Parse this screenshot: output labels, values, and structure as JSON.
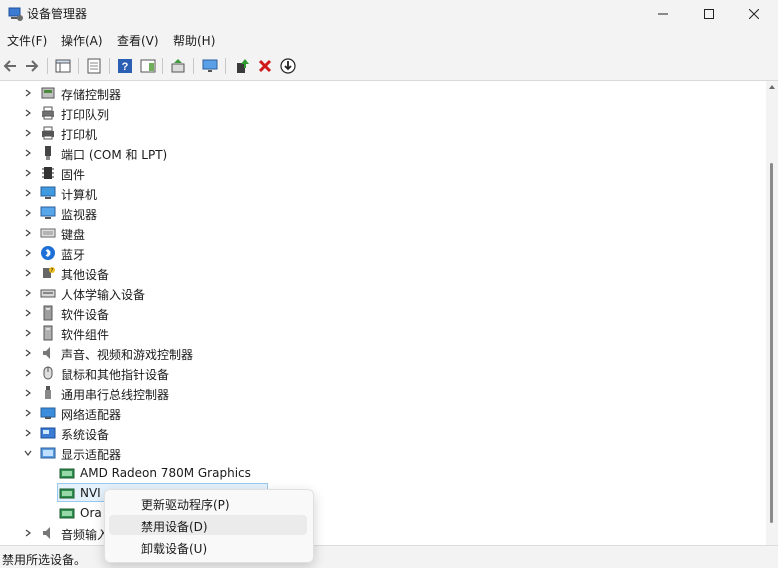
{
  "window": {
    "title": "设备管理器"
  },
  "menu": [
    "文件(F)",
    "操作(A)",
    "查看(V)",
    "帮助(H)"
  ],
  "tree": {
    "items": [
      {
        "label": "存储控制器",
        "icon": "storage-controller-icon",
        "expanded": false
      },
      {
        "label": "打印队列",
        "icon": "print-queue-icon",
        "expanded": false
      },
      {
        "label": "打印机",
        "icon": "printer-icon",
        "expanded": false
      },
      {
        "label": "端口 (COM 和 LPT)",
        "icon": "port-icon",
        "expanded": false
      },
      {
        "label": "固件",
        "icon": "firmware-icon",
        "expanded": false
      },
      {
        "label": "计算机",
        "icon": "computer-icon",
        "expanded": false
      },
      {
        "label": "监视器",
        "icon": "monitor-icon",
        "expanded": false
      },
      {
        "label": "键盘",
        "icon": "keyboard-icon",
        "expanded": false
      },
      {
        "label": "蓝牙",
        "icon": "bluetooth-icon",
        "expanded": false
      },
      {
        "label": "其他设备",
        "icon": "other-devices-icon",
        "expanded": false
      },
      {
        "label": "人体学输入设备",
        "icon": "hid-icon",
        "expanded": false
      },
      {
        "label": "软件设备",
        "icon": "software-device-icon",
        "expanded": false
      },
      {
        "label": "软件组件",
        "icon": "software-component-icon",
        "expanded": false
      },
      {
        "label": "声音、视频和游戏控制器",
        "icon": "audio-icon",
        "expanded": false
      },
      {
        "label": "鼠标和其他指针设备",
        "icon": "mouse-icon",
        "expanded": false
      },
      {
        "label": "通用串行总线控制器",
        "icon": "usb-icon",
        "expanded": false
      },
      {
        "label": "网络适配器",
        "icon": "network-adapter-icon",
        "expanded": false
      },
      {
        "label": "系统设备",
        "icon": "system-device-icon",
        "expanded": false
      },
      {
        "label": "显示适配器",
        "icon": "display-adapter-icon",
        "expanded": true
      }
    ],
    "display_children": [
      {
        "label": "AMD Radeon 780M Graphics",
        "icon": "gpu-icon"
      },
      {
        "label": "NVI",
        "icon": "gpu-icon"
      },
      {
        "label": "Ora",
        "icon": "gpu-icon"
      }
    ],
    "partial_item": {
      "label": "音频输入",
      "icon": "audio-input-icon"
    }
  },
  "context_menu": {
    "items": [
      "更新驱动程序(P)",
      "禁用设备(D)",
      "卸载设备(U)"
    ],
    "hovered_index": 1
  },
  "status": {
    "text": "禁用所选设备。"
  }
}
